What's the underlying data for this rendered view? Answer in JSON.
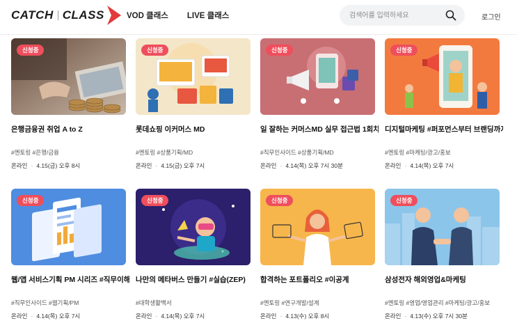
{
  "header": {
    "logo_left": "CATCH",
    "logo_right": "CLASS",
    "nav": [
      "VOD 클래스",
      "LIVE 클래스"
    ],
    "search_placeholder": "검색어를 입력하세요",
    "login": "로그인"
  },
  "colors": {
    "badge": "#ef4e5c",
    "accent": "#e23b3b"
  },
  "cards": [
    {
      "badge": "신청중",
      "title": "은행금융권 취업 A to Z",
      "tags": "#멘토링 #은행/금융",
      "mode": "온라인",
      "datetime": "4.15(금) 오후 8시",
      "image": "banking-coins-image"
    },
    {
      "badge": "신청중",
      "title": "롯데쇼핑 이커머스 MD",
      "tags": "#멘토링 #상품기획/MD",
      "mode": "온라인",
      "datetime": "4.15(금) 오후 7시",
      "image": "ecommerce-shopping-image"
    },
    {
      "badge": "신청중",
      "title": "일 잘하는 커머스MD 실무 접근법 1회차",
      "tags": "#직무인사이드 #상품기획/MD",
      "mode": "온라인",
      "datetime": "4.14(목) 오후 7시 30분",
      "image": "commerce-megaphone-image"
    },
    {
      "badge": "신청중",
      "title": "디지털마케팅 #퍼포먼스부터 브랜딩까지",
      "tags": "#멘토링 #마케팅/광고/홍보",
      "mode": "온라인",
      "datetime": "4.14(목) 오후 7시",
      "image": "digital-marketing-image"
    },
    {
      "badge": "신청중",
      "title": "웹/앱 서비스기획 PM 시리즈 #직무이해",
      "tags": "#직무인사이드 #웹기획/PM",
      "mode": "온라인",
      "datetime": "4.14(목) 오후 7시",
      "image": "web-app-screens-image"
    },
    {
      "badge": "신청중",
      "title": "나만의 메타버스 만들기 #실습(ZEP)",
      "tags": "#대학생활백서",
      "mode": "온라인",
      "datetime": "4.14(목) 오후 7시",
      "image": "metaverse-vr-image"
    },
    {
      "badge": "신청중",
      "title": "합격하는 포트폴리오 #이공계",
      "tags": "#멘토링 #연구개발/설계",
      "mode": "온라인",
      "datetime": "4.13(수) 오후 8시",
      "image": "portfolio-woman-image"
    },
    {
      "badge": "신청중",
      "title": "삼성전자 해외영업&마케팅",
      "tags": "#멘토링 #영업/영업관리 #마케팅/광고/홍보",
      "mode": "온라인",
      "datetime": "4.13(수) 오후 7시 30분",
      "image": "business-handshake-image"
    }
  ]
}
